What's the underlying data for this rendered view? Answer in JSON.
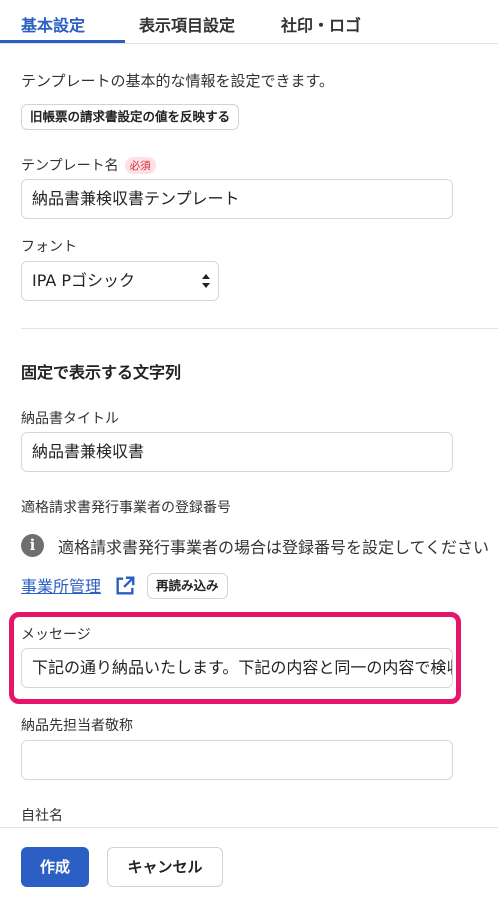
{
  "tabs": [
    {
      "label": "基本設定",
      "active": true
    },
    {
      "label": "表示項目設定",
      "active": false
    },
    {
      "label": "社印・ロゴ",
      "active": false
    }
  ],
  "description": "テンプレートの基本的な情報を設定できます。",
  "reflect_button": "旧帳票の請求書設定の値を反映する",
  "template_name": {
    "label": "テンプレート名",
    "required_badge": "必須",
    "value": "納品書兼検収書テンプレート"
  },
  "font": {
    "label": "フォント",
    "value": "IPA Pゴシック"
  },
  "fixed_strings": {
    "heading": "固定で表示する文字列",
    "title_label": "納品書タイトル",
    "title_value": "納品書兼検収書",
    "registration_label": "適格請求書発行事業者の登録番号",
    "registration_info": "適格請求書発行事業者の場合は登録番号を設定してください",
    "office_link": "事業所管理",
    "reload_button": "再読み込み",
    "message_label": "メッセージ",
    "message_value": "下記の通り納品いたします。下記の内容と同一の内容で検収",
    "honorific_label": "納品先担当者敬称",
    "honorific_value": "",
    "company_label": "自社名"
  },
  "footer": {
    "create_button": "作成",
    "cancel_button": "キャンセル"
  },
  "colors": {
    "accent": "#2b5fc4",
    "highlight": "#e5156b",
    "required": "#d5263b"
  },
  "icons": [
    "info-icon",
    "external-link-icon",
    "select-arrows-icon"
  ]
}
